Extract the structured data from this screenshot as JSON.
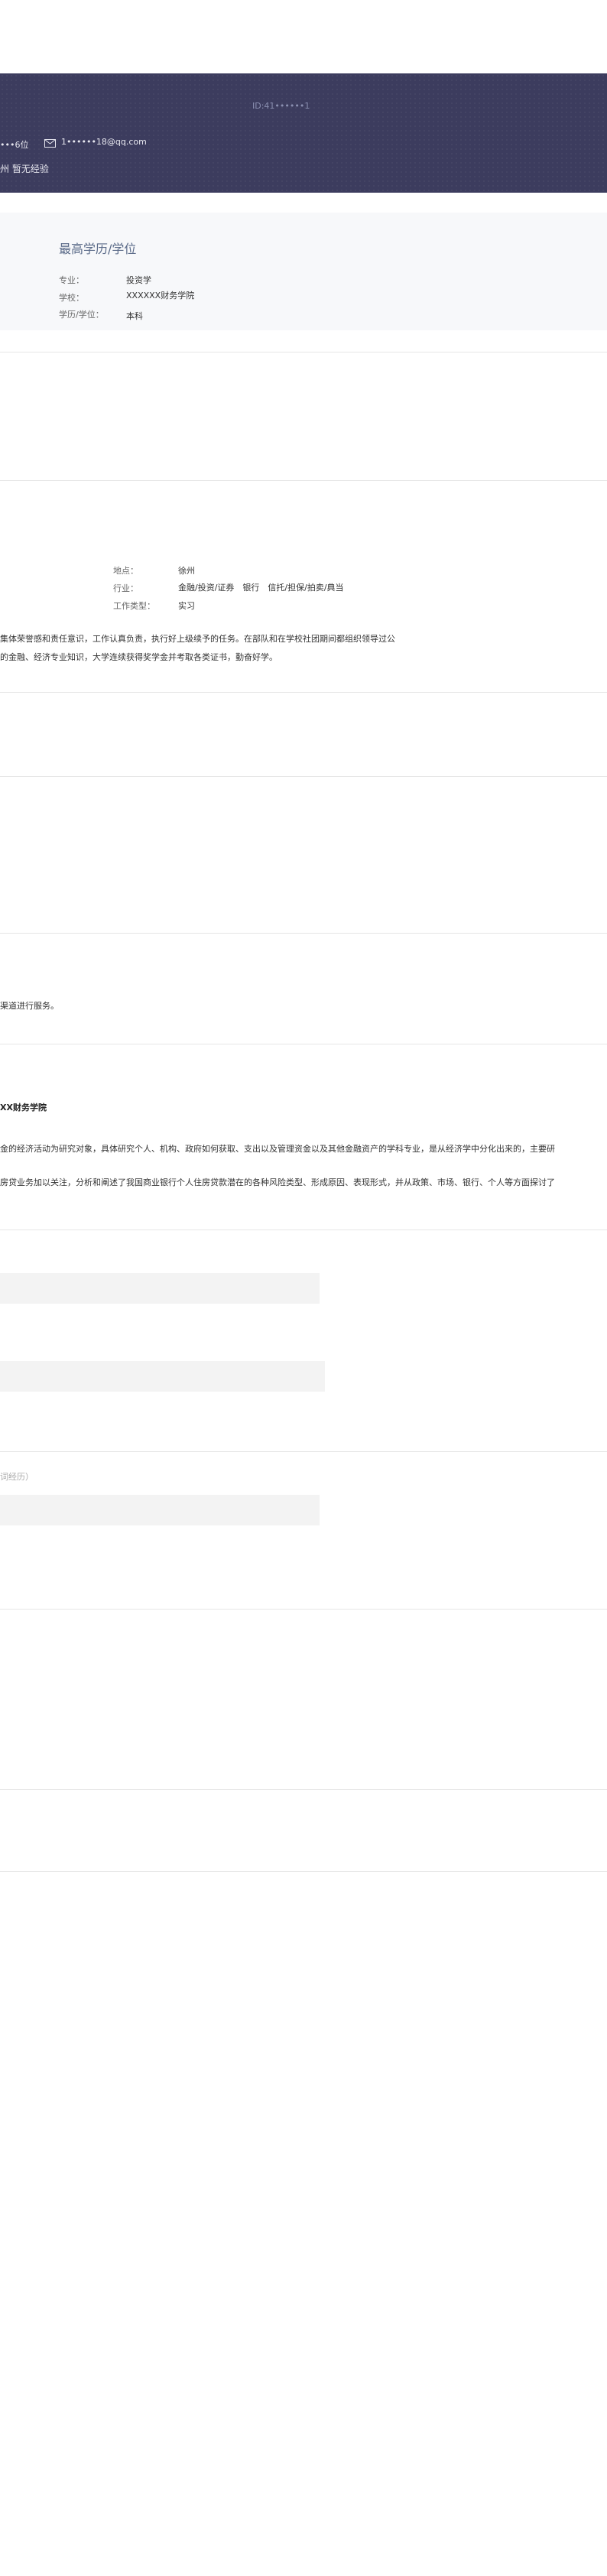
{
  "header": {
    "id_number": "ID:41••••••1",
    "phone_partial": "•••6位",
    "email": "1••••••18@qq.com",
    "subline": "州 暂无经验"
  },
  "education": {
    "title": "最高学历/学位",
    "major_label": "专业：",
    "major_value": "投资学",
    "school_label": "学校：",
    "school_value": "XXXXXX财务学院",
    "degree_label": "学历/学位：",
    "degree_value": "本科"
  },
  "job_intent": {
    "location_label": "地点：",
    "location_value": "徐州",
    "industry_label": "行业：",
    "industry_value": "金融/投资/证券　银行　信托/担保/拍卖/典当",
    "type_label": "工作类型：",
    "type_value": "实习"
  },
  "self_evaluation": {
    "line1": "集体荣誉感和责任意识，工作认真负责，执行好上级续予的任务。在部队和在学校社团期间都组织领导过公",
    "line2": "的金融、经济专业知识，大学连续获得奖学金并考取各类证书，勤奋好学。"
  },
  "other": {
    "service_text": "渠道进行服务。"
  },
  "courses": {
    "school": "XX财务学院",
    "line1": "金的经济活动为研究对象，具体研究个人、机构、政府如何获取、支出以及管理资金以及其他金融资产的学科专业，是从经济学中分化出来的，主要研",
    "line2": "房贷业务加以关注，分析和阐述了我国商业银行个人住房贷款潜在的各种风险类型、形成原因、表现形式，并从政策、市场、银行、个人等方面探讨了"
  },
  "attachments": {
    "hint": "词经历）"
  }
}
